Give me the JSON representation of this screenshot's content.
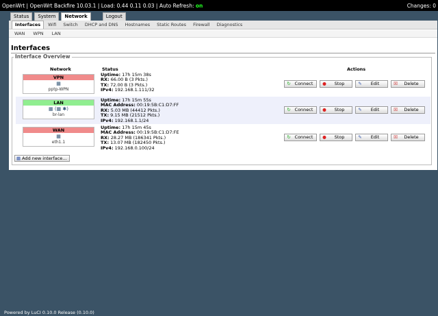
{
  "topbar": {
    "brand": "OpenWrt",
    "firmware": "OpenWrt Backfire 10.03.1",
    "load_label": "Load:",
    "load": "0.44 0.11 0.03",
    "refresh_label": "Auto Refresh:",
    "refresh_state": "on",
    "changes": "Changes: 0"
  },
  "main_tabs": [
    "Status",
    "System",
    "Network",
    "Logout"
  ],
  "sub_tabs": [
    "Interfaces",
    "Wifi",
    "Switch",
    "DHCP and DNS",
    "Hostnames",
    "Static Routes",
    "Firewall",
    "Diagnostics"
  ],
  "sub_sub_tabs": [
    "WAN",
    "WPN",
    "LAN"
  ],
  "page_title": "Interfaces",
  "overview_legend": "Interface Overview",
  "columns": {
    "network": "Network",
    "status": "Status",
    "actions": "Actions"
  },
  "colors": {
    "vpn": "#f08b8b",
    "lan": "#90ee90",
    "wan": "#f08b8b"
  },
  "interfaces": [
    {
      "name": "VPN",
      "device": "pptp-WPN",
      "icon": "network-device-icon",
      "uptime": "17h 15m 38s",
      "rx": "66.00 B (3 Pkts.)",
      "tx": "72.00 B (3 Pkts.)",
      "mac": "",
      "ipv4": "192.168.1.111/32"
    },
    {
      "name": "LAN",
      "device": "br-lan",
      "icon": "bridge-icon",
      "uptime": "17h 15m 55s",
      "mac": "00:19:5B:C1:D7:FF",
      "rx": "5.03 MB (44412 Pkts.)",
      "tx": "9.15 MB (21512 Pkts.)",
      "ipv4": "192.168.1.1/24"
    },
    {
      "name": "WAN",
      "device": "eth1.1",
      "icon": "ethernet-icon",
      "uptime": "17h 15m 45s",
      "mac": "00:19:5B:C1:D7:FE",
      "rx": "28.27 MB (186341 Pkts.)",
      "tx": "13.07 MB (182450 Pkts.)",
      "ipv4": "192.168.0.100/24"
    }
  ],
  "labels": {
    "uptime": "Uptime:",
    "mac": "MAC Address:",
    "rx": "RX:",
    "tx": "TX:",
    "ipv4": "IPv4:"
  },
  "buttons": {
    "connect": "Connect",
    "stop": "Stop",
    "edit": "Edit",
    "delete": "Delete",
    "add": "Add new interface..."
  },
  "footer": "Powered by LuCI 0.10.0 Release (0.10.0)"
}
